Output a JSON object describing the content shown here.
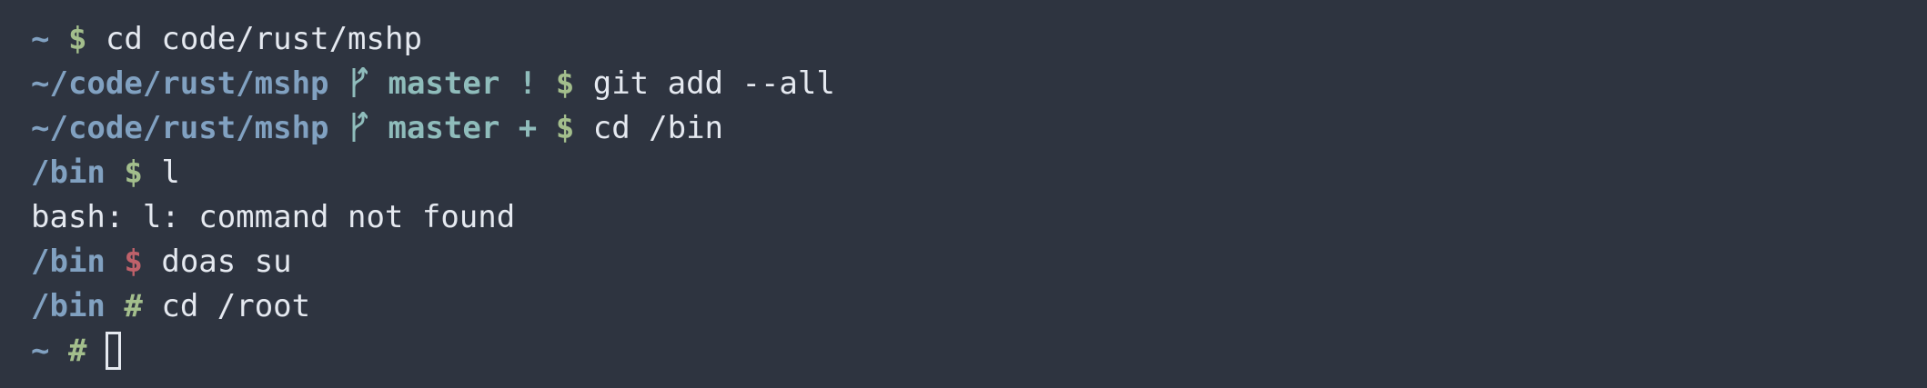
{
  "colors": {
    "background": "#2e3440",
    "path": "#81a1c1",
    "prompt_ok": "#a3be8c",
    "prompt_error": "#bf616a",
    "branch": "#8fbcbb",
    "text": "#e5e9f0"
  },
  "lines": [
    {
      "cwd": "~",
      "symbol": "$",
      "command": "cd code/rust/mshp"
    },
    {
      "cwd": "~/code/rust/mshp",
      "branch_icon": "git-branch-icon",
      "branch": "master",
      "git_status": "!",
      "symbol": "$",
      "command": "git add --all"
    },
    {
      "cwd": "~/code/rust/mshp",
      "branch_icon": "git-branch-icon",
      "branch": "master",
      "git_status": "+",
      "symbol": "$",
      "command": "cd /bin"
    },
    {
      "cwd": "/bin",
      "symbol": "$",
      "command": "l"
    },
    {
      "output": "bash: l: command not found"
    },
    {
      "cwd": "/bin",
      "symbol": "$",
      "command": "doas su"
    },
    {
      "cwd": "/bin",
      "symbol": "#",
      "command": "cd /root"
    },
    {
      "cwd": "~",
      "symbol": "#",
      "command": ""
    }
  ]
}
